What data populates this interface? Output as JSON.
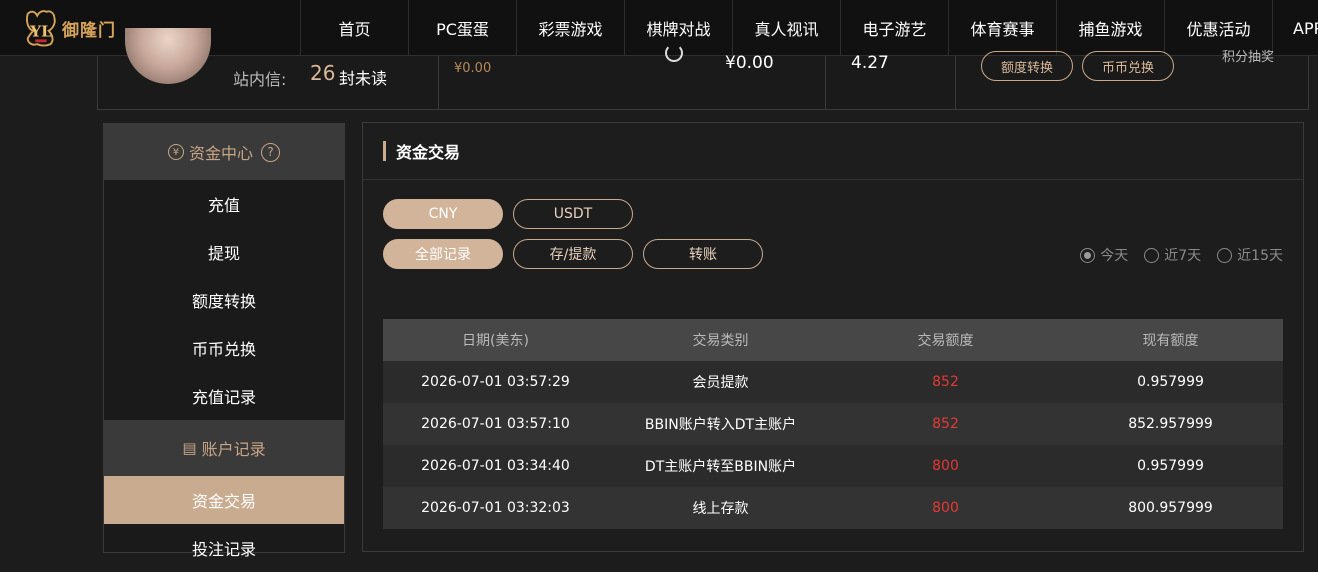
{
  "header": {
    "logo_text": "御隆门",
    "nav": [
      "首页",
      "PC蛋蛋",
      "彩票游戏",
      "棋牌对战",
      "真人视讯",
      "电子游艺",
      "体育赛事",
      "捕鱼游戏",
      "优惠活动",
      "APP"
    ]
  },
  "account": {
    "mail_label": "站内信:",
    "mail_count": "26",
    "mail_unit": "封未读",
    "balance_small": "¥0.00",
    "balance_main": "¥0.00",
    "points": "4.27",
    "quota_transfer_label": "额度转换",
    "coin_exchange_label": "币币兑换",
    "points_prize_label": "积分抽奖"
  },
  "sidebar": {
    "fund_center_label": "资金中心",
    "fund_items": [
      "充值",
      "提现",
      "额度转换",
      "币币兑换",
      "充值记录"
    ],
    "account_records_label": "账户记录",
    "record_items": [
      "资金交易",
      "投注记录"
    ],
    "active_item": "资金交易"
  },
  "main": {
    "title": "资金交易",
    "currency_tabs": [
      "CNY",
      "USDT"
    ],
    "active_currency": "CNY",
    "type_tabs": [
      "全部记录",
      "存/提款",
      "转账"
    ],
    "active_type": "全部记录",
    "range_options": [
      "今天",
      "近7天",
      "近15天"
    ],
    "active_range": "今天"
  },
  "table": {
    "headers": [
      "日期(美东)",
      "交易类别",
      "交易额度",
      "现有额度"
    ],
    "rows": [
      {
        "date": "2026-07-01 03:57:29",
        "type": "会员提款",
        "amount": "852",
        "balance": "0.957999"
      },
      {
        "date": "2026-07-01 03:57:10",
        "type": "BBIN账户转入DT主账户",
        "amount": "852",
        "balance": "852.957999"
      },
      {
        "date": "2026-07-01 03:34:40",
        "type": "DT主账户转至BBIN账户",
        "amount": "800",
        "balance": "0.957999"
      },
      {
        "date": "2026-07-01 03:32:03",
        "type": "线上存款",
        "amount": "800",
        "balance": "800.957999"
      }
    ]
  },
  "icons": {
    "fund_center": "yuan-circle-icon",
    "help": "question-circle-icon",
    "account_records": "document-icon",
    "refresh": "refresh-icon"
  },
  "colors": {
    "accent": "#c9ab8f",
    "amount": "#e53935",
    "logo": "#d6a35a"
  }
}
